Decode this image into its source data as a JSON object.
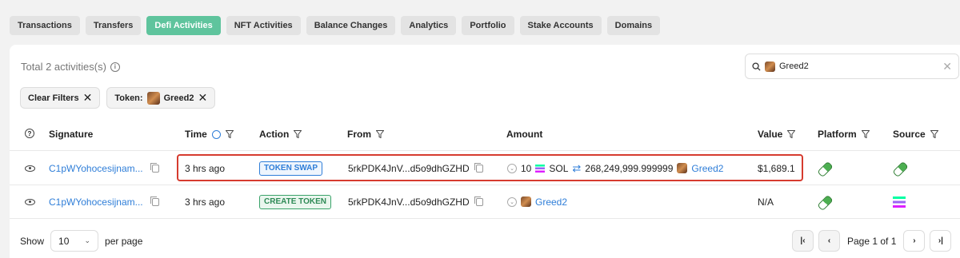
{
  "tabs": [
    "Transactions",
    "Transfers",
    "Defi Activities",
    "NFT Activities",
    "Balance Changes",
    "Analytics",
    "Portfolio",
    "Stake Accounts",
    "Domains"
  ],
  "active_tab": "Defi Activities",
  "summary": {
    "total": "Total 2 activities(s)"
  },
  "search": {
    "value": "Greed2"
  },
  "filters": {
    "clear_label": "Clear Filters",
    "token_label": "Token:",
    "token_value": "Greed2"
  },
  "columns": {
    "signature": "Signature",
    "time": "Time",
    "action": "Action",
    "from": "From",
    "amount": "Amount",
    "value": "Value",
    "platform": "Platform",
    "source": "Source"
  },
  "rows": [
    {
      "signature": "C1pWYohocesijnam...",
      "time": "3 hrs ago",
      "action": "TOKEN SWAP",
      "from": "5rkPDK4JnV...d5o9dhGZHD",
      "amount_in": "10",
      "token_in": "SOL",
      "amount_out": "268,249,999.999999",
      "token_out": "Greed2",
      "value": "$1,689.1"
    },
    {
      "signature": "C1pWYohocesijnam...",
      "time": "3 hrs ago",
      "action": "CREATE TOKEN",
      "from": "5rkPDK4JnV...d5o9dhGZHD",
      "token": "Greed2",
      "value": "N/A"
    }
  ],
  "footer": {
    "show_label": "Show",
    "page_size": "10",
    "per_page_label": "per page",
    "page_info": "Page 1 of 1"
  },
  "colors": {
    "accent": "#5fc49d",
    "link": "#2f7ed8",
    "highlight": "#d63b2f"
  }
}
